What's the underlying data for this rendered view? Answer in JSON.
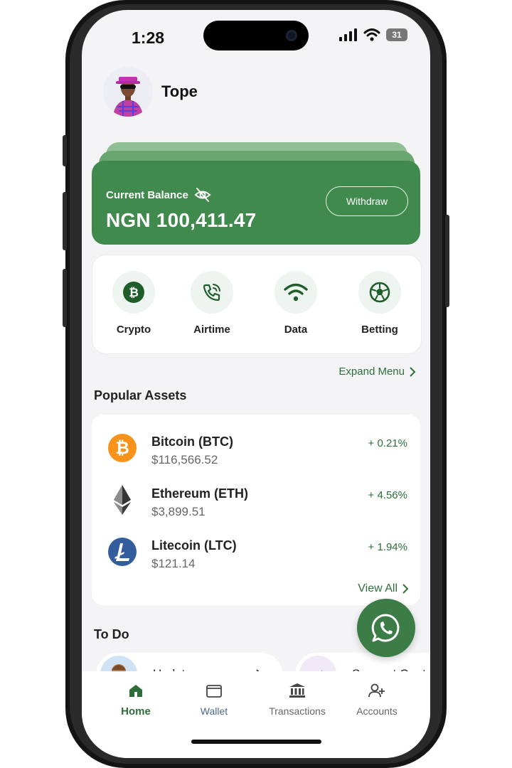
{
  "status_bar": {
    "time": "1:28",
    "battery": "31"
  },
  "profile": {
    "name": "Tope"
  },
  "balance": {
    "label": "Current Balance",
    "amount": "NGN 100,411.47",
    "withdraw_label": "Withdraw"
  },
  "quick_menu": [
    {
      "label": "Crypto",
      "icon": "bitcoin-icon"
    },
    {
      "label": "Airtime",
      "icon": "phone-call-icon"
    },
    {
      "label": "Data",
      "icon": "wifi-icon"
    },
    {
      "label": "Betting",
      "icon": "soccer-ball-icon"
    }
  ],
  "expand_menu_label": "Expand Menu",
  "popular_assets": {
    "title": "Popular Assets",
    "items": [
      {
        "name": "Bitcoin (BTC)",
        "price": "$116,566.52",
        "change": "+ 0.21%",
        "icon": "bitcoin-coin-icon",
        "color": "#f7931a"
      },
      {
        "name": "Ethereum (ETH)",
        "price": "$3,899.51",
        "change": "+ 4.56%",
        "icon": "ethereum-icon",
        "color": "#343434"
      },
      {
        "name": "Litecoin (LTC)",
        "price": "$121.14",
        "change": "+ 1.94%",
        "icon": "litecoin-icon",
        "color": "#345d9d"
      }
    ],
    "view_all_label": "View All"
  },
  "todo": {
    "title": "To Do",
    "items": [
      {
        "title": "Update your"
      },
      {
        "title": "Suggest Quot"
      }
    ]
  },
  "bottom_nav": [
    {
      "label": "Home",
      "icon": "home-icon",
      "active": true
    },
    {
      "label": "Wallet",
      "icon": "wallet-icon",
      "active": false
    },
    {
      "label": "Transactions",
      "icon": "bank-icon",
      "active": false
    },
    {
      "label": "Accounts",
      "icon": "add-user-icon",
      "active": false
    }
  ],
  "colors": {
    "brand_green": "#3f8a4c",
    "positive": "#2d6e3a",
    "background": "#f4f4f6"
  }
}
